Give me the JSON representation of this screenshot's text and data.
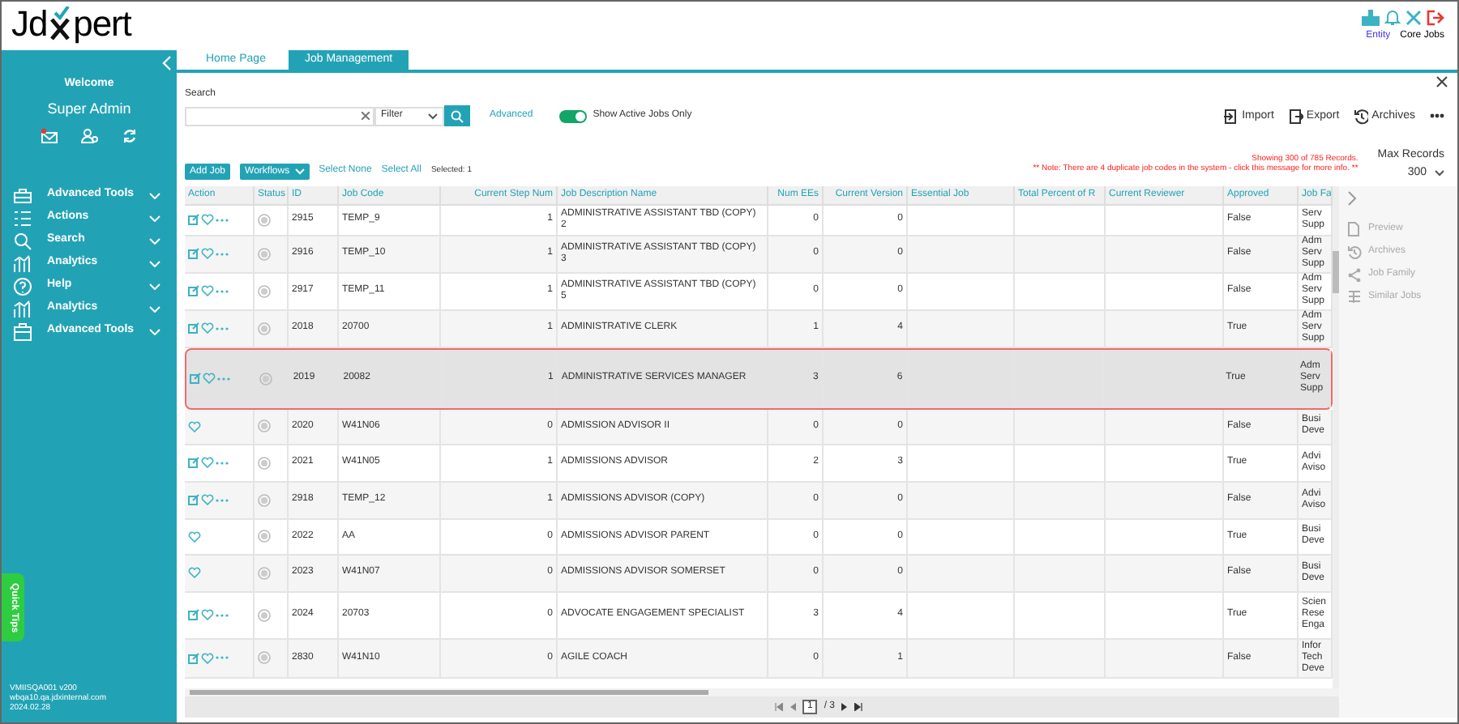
{
  "header": {
    "logo": {
      "before_mark": "Jd",
      "after_mark": "pert"
    },
    "entity_link": "Entity",
    "core_jobs": "Core Jobs"
  },
  "sidebar": {
    "welcome": "Welcome",
    "user": "Super Admin",
    "menu": [
      {
        "label": "Advanced Tools"
      },
      {
        "label": "Actions"
      },
      {
        "label": "Search"
      },
      {
        "label": "Analytics"
      },
      {
        "label": "Help"
      },
      {
        "label": "Analytics"
      },
      {
        "label": "Advanced Tools"
      }
    ],
    "quick_tips": "Quick Tips",
    "footer": [
      "VMIISQA001 v200",
      "wbqa10.qa.jdxinternal.com",
      "2024.02.28"
    ]
  },
  "tabs": [
    {
      "label": "Home Page",
      "selected": false
    },
    {
      "label": "Job Management",
      "selected": true
    }
  ],
  "search": {
    "label": "Search",
    "filter": "Filter",
    "advanced": "Advanced",
    "toggle": {
      "label": "Show Active Jobs Only",
      "on": true
    }
  },
  "top_actions": [
    "Import",
    "Export",
    "Archives"
  ],
  "toolbar": {
    "add_job": "Add Job",
    "workflows": "Workflows",
    "select_none": "Select None",
    "select_all": "Select All",
    "selected_count": "Selected: 1"
  },
  "notes": {
    "records": "Showing 300 of 785 Records.",
    "duplicates": "** Note: There are 4 duplicate job codes in the system - click this message for more info. **"
  },
  "max_records": {
    "label": "Max Records",
    "value": "300"
  },
  "table": {
    "columns": [
      "Action",
      "Status",
      "ID",
      "Job Code",
      "Current Step Num",
      "Job Description Name",
      "Num EEs",
      "Current Version",
      "Essential Job",
      "Total Percent of R",
      "Current Reviewer",
      "Approved",
      "Job Fa"
    ],
    "rows": [
      {
        "kind": "full",
        "id": "2915",
        "job_code": "TEMP_9",
        "step": "1",
        "description": "ADMINISTRATIVE ASSISTANT TBD (COPY) 2",
        "num_ees": "0",
        "version": "0",
        "approved": "False",
        "job_family": [
          "Serv",
          "Supp"
        ],
        "selected": false
      },
      {
        "kind": "full",
        "id": "2916",
        "job_code": "TEMP_10",
        "step": "1",
        "description": "ADMINISTRATIVE ASSISTANT TBD (COPY) 3",
        "num_ees": "0",
        "version": "0",
        "approved": "False",
        "job_family": [
          "Adm",
          "Serv",
          "Supp"
        ],
        "selected": false
      },
      {
        "kind": "full",
        "id": "2917",
        "job_code": "TEMP_11",
        "step": "1",
        "description": "ADMINISTRATIVE ASSISTANT TBD (COPY) 5",
        "num_ees": "0",
        "version": "0",
        "approved": "False",
        "job_family": [
          "Adm",
          "Serv",
          "Supp"
        ],
        "selected": false
      },
      {
        "kind": "full",
        "id": "2018",
        "job_code": "20700",
        "step": "1",
        "description": "ADMINISTRATIVE CLERK",
        "num_ees": "1",
        "version": "4",
        "approved": "True",
        "job_family": [
          "Adm",
          "Serv",
          "Supp"
        ],
        "selected": false
      },
      {
        "kind": "full",
        "id": "2019",
        "job_code": "20082",
        "step": "1",
        "description": "ADMINISTRATIVE SERVICES MANAGER",
        "num_ees": "3",
        "version": "6",
        "approved": "True",
        "job_family": [
          "Adm",
          "Serv",
          "Supp"
        ],
        "selected": true
      },
      {
        "kind": "favorite",
        "id": "2020",
        "job_code": "W41N06",
        "step": "0",
        "description": "ADMISSION ADVISOR II",
        "num_ees": "0",
        "version": "0",
        "approved": "False",
        "job_family": [
          "Busi",
          "Deve"
        ],
        "selected": false
      },
      {
        "kind": "full",
        "id": "2021",
        "job_code": "W41N05",
        "step": "1",
        "description": "ADMISSIONS ADVISOR",
        "num_ees": "2",
        "version": "3",
        "approved": "True",
        "job_family": [
          "Advi",
          "Aviso"
        ],
        "selected": false
      },
      {
        "kind": "full",
        "id": "2918",
        "job_code": "TEMP_12",
        "step": "1",
        "description": "ADMISSIONS ADVISOR (COPY)",
        "num_ees": "0",
        "version": "0",
        "approved": "False",
        "job_family": [
          "Advi",
          "Aviso"
        ],
        "selected": false
      },
      {
        "kind": "favorite",
        "id": "2022",
        "job_code": "AA",
        "step": "0",
        "description": "ADMISSIONS ADVISOR PARENT",
        "num_ees": "0",
        "version": "0",
        "approved": "True",
        "job_family": [
          "Busi",
          "Deve"
        ],
        "selected": false
      },
      {
        "kind": "favorite",
        "id": "2023",
        "job_code": "W41N07",
        "step": "0",
        "description": "ADMISSIONS ADVISOR SOMERSET",
        "num_ees": "0",
        "version": "0",
        "approved": "False",
        "job_family": [
          "Busi",
          "Deve"
        ],
        "selected": false
      },
      {
        "kind": "full",
        "id": "2024",
        "job_code": "20703",
        "step": "0",
        "description": "ADVOCATE ENGAGEMENT SPECIALIST",
        "num_ees": "3",
        "version": "4",
        "approved": "True",
        "job_family": [
          "Scien",
          "Rese",
          "Enga"
        ],
        "selected": false
      },
      {
        "kind": "full",
        "id": "2830",
        "job_code": "W41N10",
        "step": "0",
        "description": "AGILE COACH",
        "num_ees": "0",
        "version": "1",
        "approved": "False",
        "job_family": [
          "Infor",
          "Tech",
          "Deve"
        ],
        "selected": false
      }
    ]
  },
  "pager": {
    "page": "1",
    "total": "/ 3"
  },
  "side_panel": {
    "items": [
      {
        "label": "Preview",
        "disabled": true
      },
      {
        "label": "Archives",
        "disabled": true
      },
      {
        "label": "Job Family",
        "disabled": true
      },
      {
        "label": "Similar Jobs",
        "disabled": true
      }
    ]
  }
}
